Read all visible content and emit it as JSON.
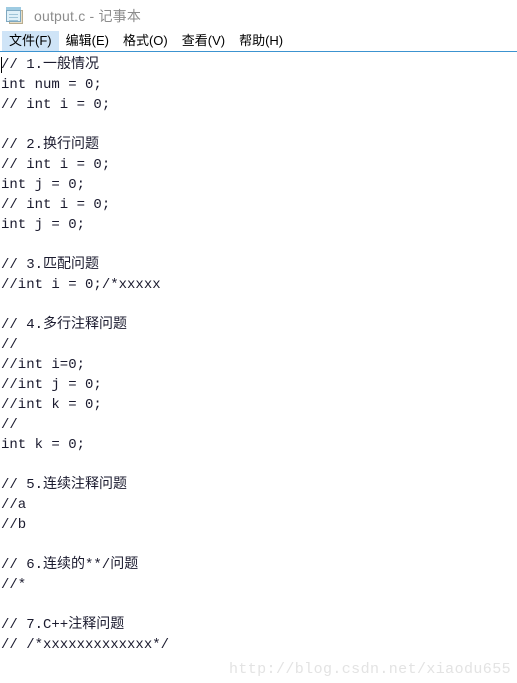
{
  "window": {
    "icon": "notepad-icon",
    "title": "output.c - 记事本"
  },
  "menubar": {
    "items": [
      {
        "label": "文件(F)",
        "active": true
      },
      {
        "label": "编辑(E)",
        "active": false
      },
      {
        "label": "格式(O)",
        "active": false
      },
      {
        "label": "查看(V)",
        "active": false
      },
      {
        "label": "帮助(H)",
        "active": false
      }
    ]
  },
  "editor": {
    "caret_line": 0,
    "caret_column": 0,
    "lines": [
      "// 1.一般情况",
      "int num = 0;",
      "// int i = 0;",
      "",
      "// 2.换行问题",
      "// int i = 0;",
      "int j = 0;",
      "// int i = 0;",
      "int j = 0;",
      "",
      "// 3.匹配问题",
      "//int i = 0;/*xxxxx",
      "",
      "// 4.多行注释问题",
      "//",
      "//int i=0;",
      "//int j = 0;",
      "//int k = 0;",
      "//",
      "int k = 0;",
      "",
      "// 5.连续注释问题",
      "//a",
      "//b",
      "",
      "// 6.连续的**/问题",
      "//*",
      "",
      "// 7.C++注释问题",
      "// /*xxxxxxxxxxxxx*/"
    ]
  },
  "watermark": {
    "text": "http://blog.csdn.net/xiaodu655"
  },
  "colors": {
    "menu_highlight": "#cfe4f7",
    "menu_underline": "#3c93d0",
    "title_text": "#8c8c8c",
    "code_text": "#1a1a2e",
    "watermark_text": "#e3e3e3",
    "background": "#ffffff"
  }
}
